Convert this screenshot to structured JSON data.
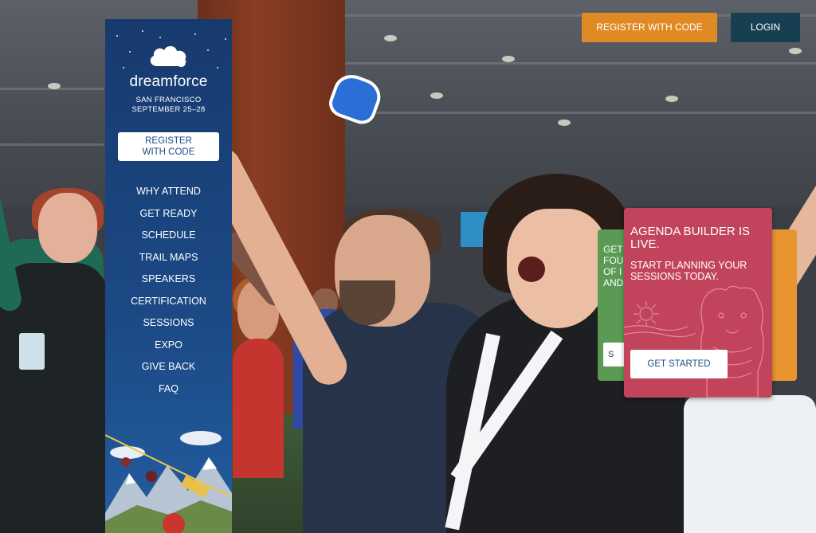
{
  "header": {
    "register_label": "REGISTER WITH CODE",
    "login_label": "LOGIN"
  },
  "sidebar": {
    "logo_text": "dreamforce",
    "city": "SAN FRANCISCO",
    "dates": "SEPTEMBER 25–28",
    "register_line1": "REGISTER",
    "register_line2": "WITH CODE",
    "nav": [
      {
        "label": "WHY ATTEND"
      },
      {
        "label": "GET READY"
      },
      {
        "label": "SCHEDULE"
      },
      {
        "label": "TRAIL MAPS"
      },
      {
        "label": "SPEAKERS"
      },
      {
        "label": "CERTIFICATION"
      },
      {
        "label": "SESSIONS"
      },
      {
        "label": "EXPO"
      },
      {
        "label": "GIVE BACK"
      },
      {
        "label": "FAQ"
      }
    ]
  },
  "promo": {
    "title": "AGENDA BUILDER IS LIVE.",
    "subtitle": "START PLANNING YOUR SESSIONS TODAY.",
    "button_label": "GET STARTED",
    "back_card_text": "GET\nFOU\nOF I\nAND",
    "back_card_button": "S"
  },
  "colors": {
    "orange": "#e08a26",
    "navy": "#163f52",
    "sidebar_blue": "#1c4a86",
    "card_red": "#c2445c",
    "card_green": "#5a9a53"
  },
  "icons": {
    "logo": "salesforce-cloud-icon",
    "mountains": "mountain-illustration",
    "bear": "bear-illustration",
    "sun": "sun-icon"
  }
}
